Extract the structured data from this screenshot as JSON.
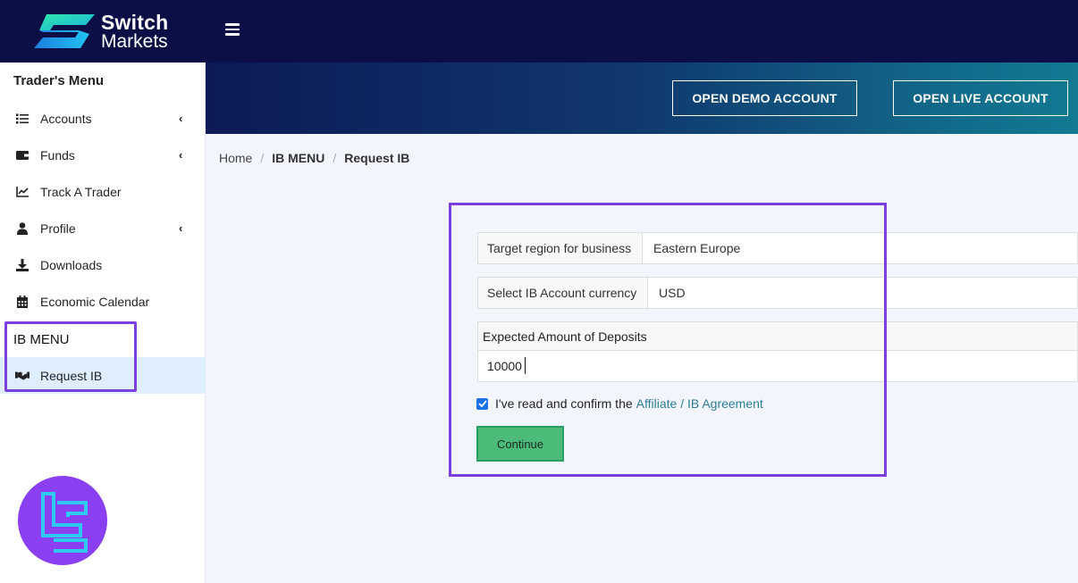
{
  "brand": {
    "name_line1": "Switch",
    "name_line2": "Markets"
  },
  "header": {
    "menu_icon": "hamburger-icon",
    "open_demo_label": "OPEN DEMO ACCOUNT",
    "open_live_label": "OPEN LIVE ACCOUNT"
  },
  "sidebar": {
    "title": "Trader's Menu",
    "items": [
      {
        "label": "Accounts",
        "icon": "list-icon",
        "has_submenu": true
      },
      {
        "label": "Funds",
        "icon": "wallet-icon",
        "has_submenu": true
      },
      {
        "label": "Track A Trader",
        "icon": "chart-line-icon",
        "has_submenu": false
      },
      {
        "label": "Profile",
        "icon": "user-icon",
        "has_submenu": true
      },
      {
        "label": "Downloads",
        "icon": "download-icon",
        "has_submenu": false
      },
      {
        "label": "Economic Calendar",
        "icon": "calendar-icon",
        "has_submenu": false
      }
    ],
    "ib_title": "IB MENU",
    "ib_items": [
      {
        "label": "Request IB",
        "icon": "handshake-icon",
        "active": true
      }
    ]
  },
  "breadcrumb": {
    "home": "Home",
    "section": "IB MENU",
    "current": "Request IB",
    "separator": "/"
  },
  "form": {
    "region_label": "Target region for business",
    "region_value": "Eastern Europe",
    "currency_label": "Select IB Account currency",
    "currency_value": "USD",
    "deposits_label": "Expected Amount of Deposits",
    "deposits_value": "10000",
    "agreement_checked": true,
    "agreement_text": "I've read and confirm the",
    "agreement_link": "Affiliate / IB Agreement",
    "continue_label": "Continue"
  },
  "colors": {
    "topbar": "#0b0f45",
    "highlight": "#7b3fe0",
    "continue": "#4cbb7a",
    "link": "#2f7c96",
    "active_item": "#dfeefd"
  }
}
